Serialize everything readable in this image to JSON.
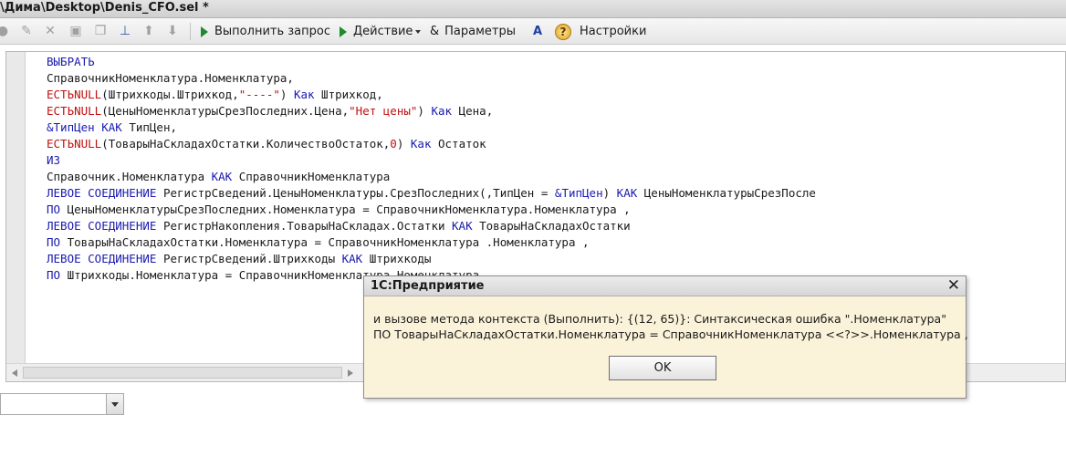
{
  "window": {
    "title": "\\Дима\\Desktop\\Denis_CFO.sel *"
  },
  "toolbar": {
    "run_label": "Выполнить запрос",
    "actions_label": "Действие",
    "params_label": "Параметры",
    "settings_label": "Настройки",
    "params_glyph": "&",
    "help_glyph": "?"
  },
  "editor": {
    "lines": [
      [
        {
          "t": "ВЫБРАТЬ",
          "c": "kw"
        }
      ],
      [
        {
          "t": "СправочникНоменклатура.Номенклатура,",
          "c": ""
        }
      ],
      [
        {
          "t": "ЕСТЬNULL",
          "c": "str"
        },
        {
          "t": "(Штрихкоды.Штрихкод,",
          "c": ""
        },
        {
          "t": "\"----\"",
          "c": "str"
        },
        {
          "t": ") ",
          "c": ""
        },
        {
          "t": "Как",
          "c": "kw"
        },
        {
          "t": " Штрихкод,",
          "c": ""
        }
      ],
      [
        {
          "t": "ЕСТЬNULL",
          "c": "str"
        },
        {
          "t": "(ЦеныНоменклатурыСрезПоследних.Цена,",
          "c": ""
        },
        {
          "t": "\"Нет цены\"",
          "c": "str"
        },
        {
          "t": ") ",
          "c": ""
        },
        {
          "t": "Как",
          "c": "kw"
        },
        {
          "t": " Цена,",
          "c": ""
        }
      ],
      [
        {
          "t": "&ТипЦен",
          "c": "kw"
        },
        {
          "t": " ",
          "c": ""
        },
        {
          "t": "КАК",
          "c": "kw"
        },
        {
          "t": " ТипЦен,",
          "c": ""
        }
      ],
      [
        {
          "t": "ЕСТЬNULL",
          "c": "str"
        },
        {
          "t": "(ТоварыНаСкладахОстатки.КоличествоОстаток,",
          "c": ""
        },
        {
          "t": "0",
          "c": "str"
        },
        {
          "t": ") ",
          "c": ""
        },
        {
          "t": "Как",
          "c": "kw"
        },
        {
          "t": " Остаток",
          "c": ""
        }
      ],
      [
        {
          "t": "ИЗ",
          "c": "kw"
        }
      ],
      [
        {
          "t": "Справочник.Номенклатура ",
          "c": ""
        },
        {
          "t": "КАК",
          "c": "kw"
        },
        {
          "t": " СправочникНоменклатура",
          "c": ""
        }
      ],
      [
        {
          "t": "ЛЕВОЕ СОЕДИНЕНИЕ",
          "c": "kw"
        },
        {
          "t": " РегистрСведений.ЦеныНоменклатуры.СрезПоследних(,ТипЦен = ",
          "c": ""
        },
        {
          "t": "&ТипЦен",
          "c": "kw"
        },
        {
          "t": ") ",
          "c": ""
        },
        {
          "t": "КАК",
          "c": "kw"
        },
        {
          "t": " ЦеныНоменклатурыСрезПосле",
          "c": ""
        }
      ],
      [
        {
          "t": "ПО",
          "c": "kw"
        },
        {
          "t": " ЦеныНоменклатурыСрезПоследних.Номенклатура = СправочникНоменклатура.Номенклатура ,",
          "c": ""
        }
      ],
      [
        {
          "t": "ЛЕВОЕ СОЕДИНЕНИЕ",
          "c": "kw"
        },
        {
          "t": " РегистрНакопления.ТоварыНаСкладах.Остатки ",
          "c": ""
        },
        {
          "t": "КАК",
          "c": "kw"
        },
        {
          "t": " ТоварыНаСкладахОстатки",
          "c": ""
        }
      ],
      [
        {
          "t": "ПО",
          "c": "kw"
        },
        {
          "t": " ТоварыНаСкладахОстатки.Номенклатура = СправочникНоменклатура .Номенклатура ,",
          "c": ""
        }
      ],
      [
        {
          "t": "ЛЕВОЕ СОЕДИНЕНИЕ",
          "c": "kw"
        },
        {
          "t": " РегистрСведений.Штрихкоды ",
          "c": ""
        },
        {
          "t": "КАК",
          "c": "kw"
        },
        {
          "t": " Штрихкоды",
          "c": ""
        }
      ],
      [
        {
          "t": "ПО",
          "c": "kw"
        },
        {
          "t": " Штрихкоды.Номенклатура = СправочникНоменклатура.Номенклатура",
          "c": ""
        }
      ]
    ]
  },
  "dialog": {
    "title": "1С:Предприятие",
    "close_glyph": "✕",
    "message_line1": "и вызове метода контекста (Выполнить): {(12, 65)}: Синтаксическая ошибка \".Номенклатура\"",
    "message_line2": "ПО ТоварыНаСкладахОстатки.Номенклатура = СправочникНоменклатура <<?>>.Номенклатура ,",
    "ok_label": "OK"
  },
  "colors": {
    "keyword": "#1a1ab0",
    "string": "#c01010",
    "dialog_bg": "#fbf3d9"
  }
}
